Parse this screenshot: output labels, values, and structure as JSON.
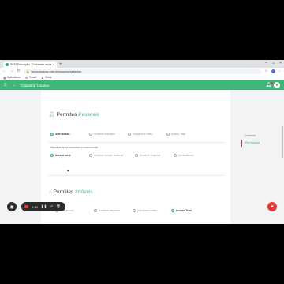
{
  "browser": {
    "tab_title": "SESI Educação · Cadastrar usuário",
    "tab_close": "×",
    "new_tab": "+",
    "window_controls": [
      "–",
      "□",
      "×"
    ],
    "url": "sesi.educacao.com.br/usuarios/cadastrar",
    "bookmarks": [
      "Aplicativos",
      "Gmail",
      "Drive"
    ]
  },
  "app": {
    "title": "Cadastrar Usuário",
    "accent_color": "#3cb779"
  },
  "side_nav": {
    "items": [
      "Cadastro",
      "Permissões"
    ],
    "active_index": 1
  },
  "pessoais": {
    "title_prefix": "Permites",
    "title_accent": "Pessoais",
    "options": [
      "Sem acesso",
      "Somente visualizar",
      "Visualizar e editar",
      "Acesso Total"
    ],
    "selected_index": 0,
    "sub_label": "Visualizar ao se encontrar no mesmo local",
    "sub_options": [
      "Acesso local",
      "Somente Acesso Nacional",
      "Somente Regional",
      "Administrador"
    ],
    "sub_selected_index": 0
  },
  "imoveis": {
    "title_prefix": "Permites",
    "title_accent": "Imóveis",
    "options": [
      "Sem acesso",
      "Somente visualizar",
      "Visualizar e editar",
      "Acesso Total"
    ],
    "selected_index": 3
  },
  "recorder": {
    "time": "0:30"
  }
}
